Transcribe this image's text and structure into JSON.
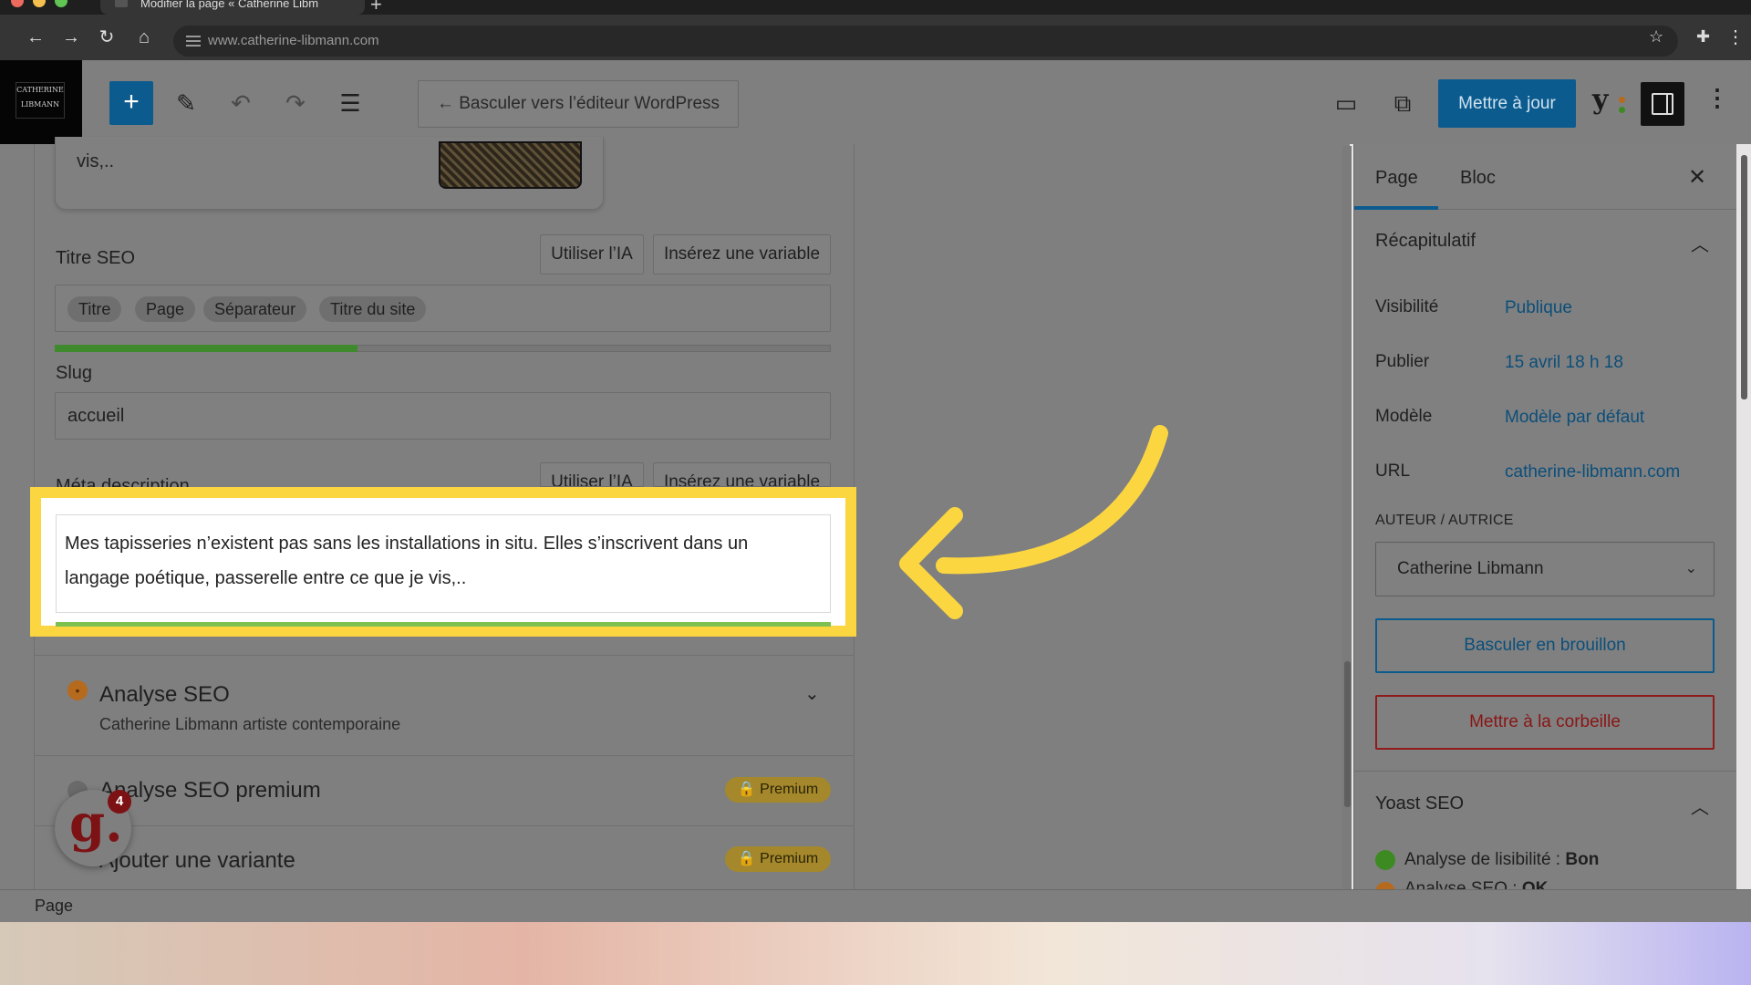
{
  "browser": {
    "tab_title": "Modifier la page « Catherine Libm",
    "new_tab": "+",
    "url": "www.catherine-libmann.com"
  },
  "editor": {
    "logo_text_line1": "CATHERINE",
    "logo_text_line2": "LIBMANN",
    "switch_editor_label": "← Basculer vers l’éditeur WordPress",
    "update_label": "Mettre à jour"
  },
  "seo": {
    "preview_snippet": "vis,..",
    "title_label": "Titre SEO",
    "ai_button": "Utiliser l’IA",
    "variable_button": "Insérez une variable",
    "title_chips": [
      "Titre",
      "Page",
      "Séparateur",
      "Titre du site"
    ],
    "title_progress": 0.39,
    "slug_label": "Slug",
    "slug_value": "accueil",
    "meta_label": "Méta description",
    "meta_line1": "Mes tapisseries n’existent pas sans les installations in situ. Elles s’inscrivent dans un",
    "meta_line2": "langage poétique, passerelle entre ce que je vis,..",
    "analysis_title": "Analyse SEO",
    "analysis_subtitle": "Catherine Libmann artiste contemporaine",
    "premium_analysis_title": "Analyse SEO premium",
    "premium_badge": "Premium",
    "variant_title": "Ajouter une variante",
    "chat_badge_count": "4"
  },
  "sidebar": {
    "tab_page": "Page",
    "tab_block": "Bloc",
    "summary_title": "Récapitulatif",
    "rows": [
      {
        "key": "Visibilité",
        "value": "Publique"
      },
      {
        "key": "Publier",
        "value": "15 avril 18 h 18"
      },
      {
        "key": "Modèle",
        "value": "Modèle par défaut"
      },
      {
        "key": "URL",
        "value": "catherine-libmann.com"
      }
    ],
    "author_label": "AUTEUR / AUTRICE",
    "author_value": "Catherine Libmann",
    "draft_button": "Basculer en brouillon",
    "trash_button": "Mettre à la corbeille",
    "yoast_title": "Yoast SEO",
    "readability_label": "Analyse de lisibilité : ",
    "readability_value": "Bon",
    "seo_label": "Analyse SEO : ",
    "seo_value": "OK"
  },
  "footer": {
    "breadcrumb": "Page"
  },
  "colors": {
    "accent": "#0b5b8f",
    "highlight": "#fcd641",
    "good": "#3d8a23",
    "ok": "#b66a1e",
    "danger": "#8f1b1b"
  }
}
